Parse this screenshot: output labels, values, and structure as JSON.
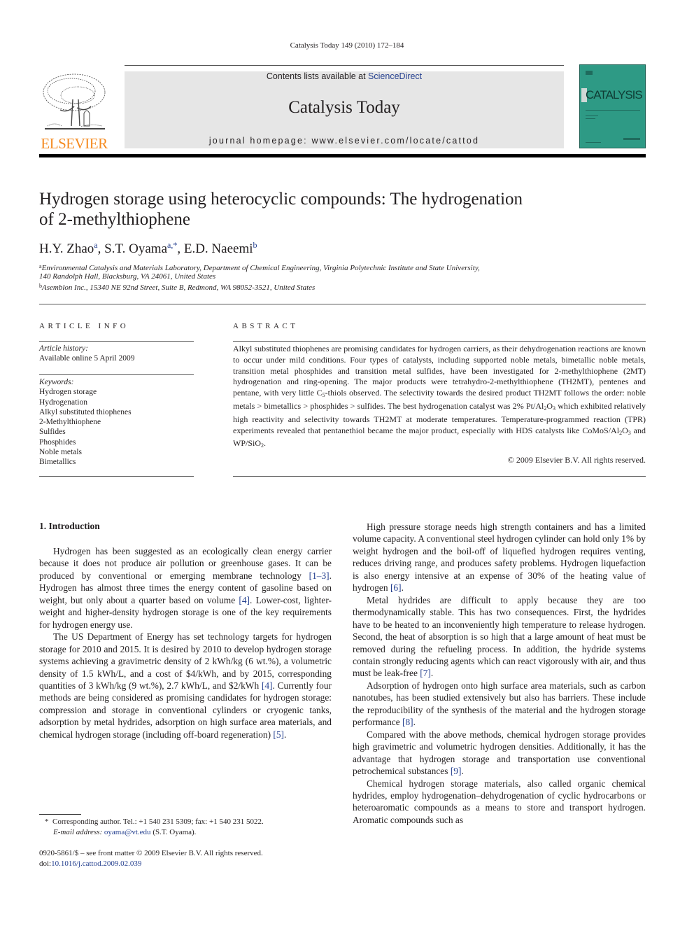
{
  "header": {
    "running_head": "Catalysis Today 149 (2010) 172–184",
    "publisher_logo_text": "ELSEVIER",
    "contents_prefix": "Contents lists available at ",
    "contents_link": "ScienceDirect",
    "journal_title": "Catalysis Today",
    "homepage_label": "journal homepage: ",
    "homepage_url": "www.elsevier.com/locate/cattod",
    "cover_title": "CATALYSIS",
    "colors": {
      "publisher_orange": "#f58a1f",
      "cover_teal": "#2e9a85",
      "link_blue": "#25408f",
      "masthead_gray": "#e6e6e6"
    }
  },
  "article": {
    "title_line1": "Hydrogen storage using heterocyclic compounds: The hydrogenation",
    "title_line2": "of 2-methylthiophene",
    "authors": [
      {
        "name": "H.Y. Zhao",
        "sup": "a"
      },
      {
        "name": "S.T. Oyama",
        "sup": "a,*"
      },
      {
        "name": "E.D. Naeemi",
        "sup": "b"
      }
    ],
    "affiliations": [
      {
        "mark": "a",
        "line1": "Environmental Catalysis and Materials Laboratory, Department of Chemical Engineering, Virginia Polytechnic Institute and State University,",
        "line2": "140 Randolph Hall, Blacksburg, VA 24061, United States"
      },
      {
        "mark": "b",
        "line1": "Asemblon Inc., 15340 NE 92nd Street, Suite B, Redmond, WA 98052-3521, United States"
      }
    ]
  },
  "article_info": {
    "heading": "ARTICLE INFO",
    "history_label": "Article history:",
    "history_value": "Available online 5 April 2009",
    "keywords_label": "Keywords:",
    "keywords": [
      "Hydrogen storage",
      "Hydrogenation",
      "Alkyl substituted thiophenes",
      "2-Methylthiophene",
      "Sulfides",
      "Phosphides",
      "Noble metals",
      "Bimetallics"
    ]
  },
  "abstract": {
    "heading": "ABSTRACT",
    "text_1": "Alkyl substituted thiophenes are promising candidates for hydrogen carriers, as their dehydrogenation reactions are known to occur under mild conditions. Four types of catalysts, including supported noble metals, bimetallic noble metals, transition metal phosphides and transition metal sulfides, have been investigated for 2-methylthiophene (2MT) hydrogenation and ring-opening. The major products were tetrahydro-2-methylthiophene (TH2MT), pentenes and pentane, with very little C",
    "sub_1": "5",
    "text_2": "-thiols observed. The selectivity towards the desired product TH2MT follows the order: noble metals > bimetallics > phosphides > sulfides. The best hydrogenation catalyst was 2% Pt/Al",
    "sub_2": "2",
    "text_3": "O",
    "sub_3": "3",
    "text_4": " which exhibited relatively high reactivity and selectivity towards TH2MT at moderate temperatures. Temperature-programmed reaction (TPR) experiments revealed that pentanethiol became the major product, especially with HDS catalysts like CoMoS/Al",
    "sub_4": "2",
    "text_5": "O",
    "sub_5": "3",
    "text_6": " and WP/SiO",
    "sub_6": "2",
    "text_7": ".",
    "copyright": "© 2009 Elsevier B.V. All rights reserved."
  },
  "body": {
    "section_heading": "1.  Introduction",
    "left_paragraphs": [
      {
        "parts": [
          "Hydrogen has been suggested as an ecologically clean energy carrier because it does not produce air pollution or greenhouse gases. It can be produced by conventional or emerging membrane technology ",
          {
            "ref": "[1–3]"
          },
          ". Hydrogen has almost three times the energy content of gasoline based on weight, but only about a quarter based on volume ",
          {
            "ref": "[4]"
          },
          ". Lower-cost, lighter-weight and higher-density hydrogen storage is one of the key requirements for hydrogen energy use."
        ]
      },
      {
        "parts": [
          "The US Department of Energy has set technology targets for hydrogen storage for 2010 and 2015. It is desired by 2010 to develop hydrogen storage systems achieving a gravimetric density of 2 kWh/kg (6 wt.%), a volumetric density of 1.5 kWh/L, and a cost of $4/kWh, and by 2015, corresponding quantities of 3 kWh/kg (9 wt.%), 2.7 kWh/L, and $2/kWh ",
          {
            "ref": "[4]"
          },
          ". Currently four methods are being considered as promising candidates for hydrogen storage: compression and storage in conventional cylinders or cryogenic tanks, adsorption by metal hydrides, adsorption on high surface area materials, and chemical hydrogen storage (including off-board regeneration) ",
          {
            "ref": "[5]"
          },
          "."
        ]
      }
    ],
    "right_paragraphs": [
      {
        "parts": [
          "High pressure storage needs high strength containers and has a limited volume capacity. A conventional steel hydrogen cylinder can hold only 1% by weight hydrogen and the boil-off of liquefied hydrogen requires venting, reduces driving range, and produces safety problems. Hydrogen liquefaction is also energy intensive at an expense of 30% of the heating value of hydrogen ",
          {
            "ref": "[6]"
          },
          "."
        ]
      },
      {
        "parts": [
          "Metal hydrides are difficult to apply because they are too thermodynamically stable. This has two consequences. First, the hydrides have to be heated to an inconveniently high temperature to release hydrogen. Second, the heat of absorption is so high that a large amount of heat must be removed during the refueling process. In addition, the hydride systems contain strongly reducing agents which can react vigorously with air, and thus must be leak-free ",
          {
            "ref": "[7]"
          },
          "."
        ]
      },
      {
        "parts": [
          "Adsorption of hydrogen onto high surface area materials, such as carbon nanotubes, has been studied extensively but also has barriers. These include the reproducibility of the synthesis of the material and the hydrogen storage performance ",
          {
            "ref": "[8]"
          },
          "."
        ]
      },
      {
        "parts": [
          "Compared with the above methods, chemical hydrogen storage provides high gravimetric and volumetric hydrogen densities. Additionally, it has the advantage that hydrogen storage and transportation use conventional petrochemical substances ",
          {
            "ref": "[9]"
          },
          "."
        ]
      },
      {
        "parts": [
          "Chemical hydrogen storage materials, also called organic chemical hydrides, employ hydrogenation–dehydrogenation of cyclic hydrocarbons or heteroaromatic compounds as a means to store and transport hydrogen. Aromatic compounds such as"
        ]
      }
    ]
  },
  "footnotes": {
    "corresponding_mark": "*",
    "corresponding_text": "Corresponding author. Tel.: +1 540 231 5309; fax: +1 540 231 5022.",
    "email_label": "E-mail address:",
    "email": "oyama@vt.edu",
    "email_suffix": " (S.T. Oyama).",
    "front_matter": "0920-5861/$ – see front matter © 2009 Elsevier B.V. All rights reserved.",
    "doi_label": "doi:",
    "doi": "10.1016/j.cattod.2009.02.039"
  }
}
